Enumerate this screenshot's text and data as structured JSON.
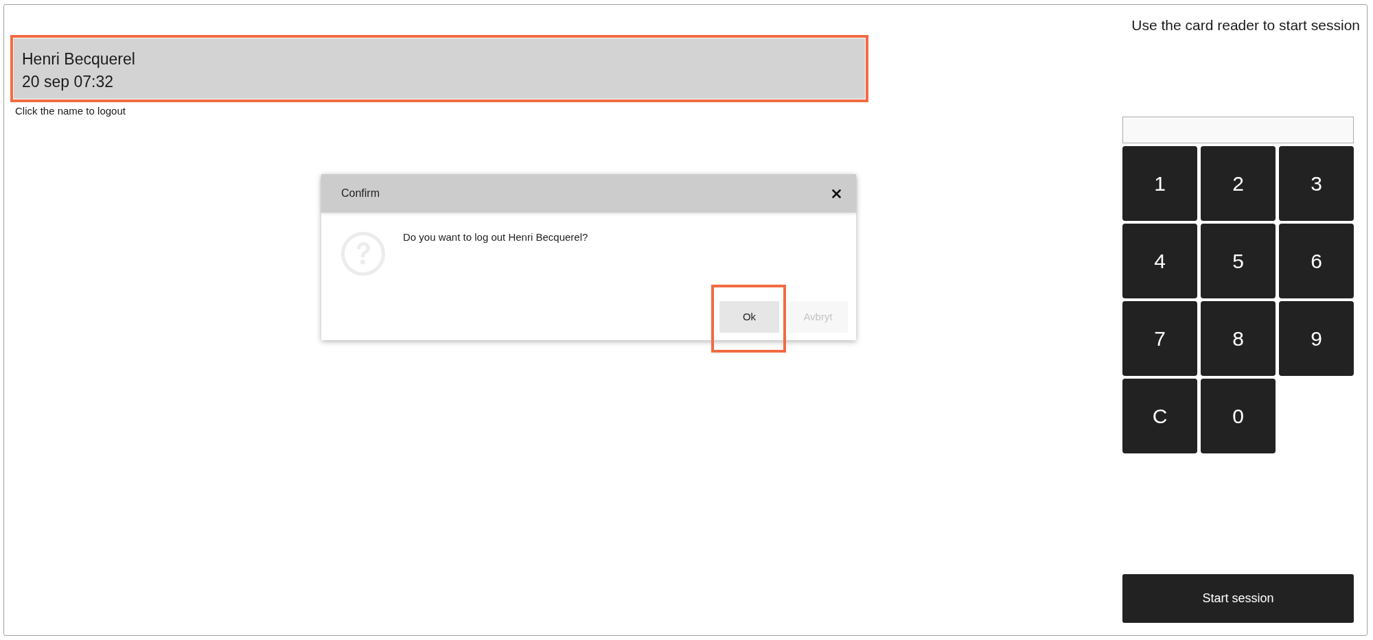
{
  "header": {
    "instruction": "Use the card reader to start session"
  },
  "session_card": {
    "name": "Henri Becquerel",
    "time": "20 sep 07:32",
    "highlighted": true
  },
  "hint": "Click the name to logout",
  "dialog": {
    "title": "Confirm",
    "message": "Do you want to log out Henri Becquerel?",
    "buttons": [
      {
        "label": "Ok",
        "disabled": false,
        "highlighted": true
      },
      {
        "label": "Avbryt",
        "disabled": true,
        "highlighted": false
      }
    ]
  },
  "keypad": {
    "keys": [
      "1",
      "2",
      "3",
      "4",
      "5",
      "6",
      "7",
      "8",
      "9",
      "C",
      "0"
    ]
  },
  "start_button": {
    "label": "Start session"
  }
}
